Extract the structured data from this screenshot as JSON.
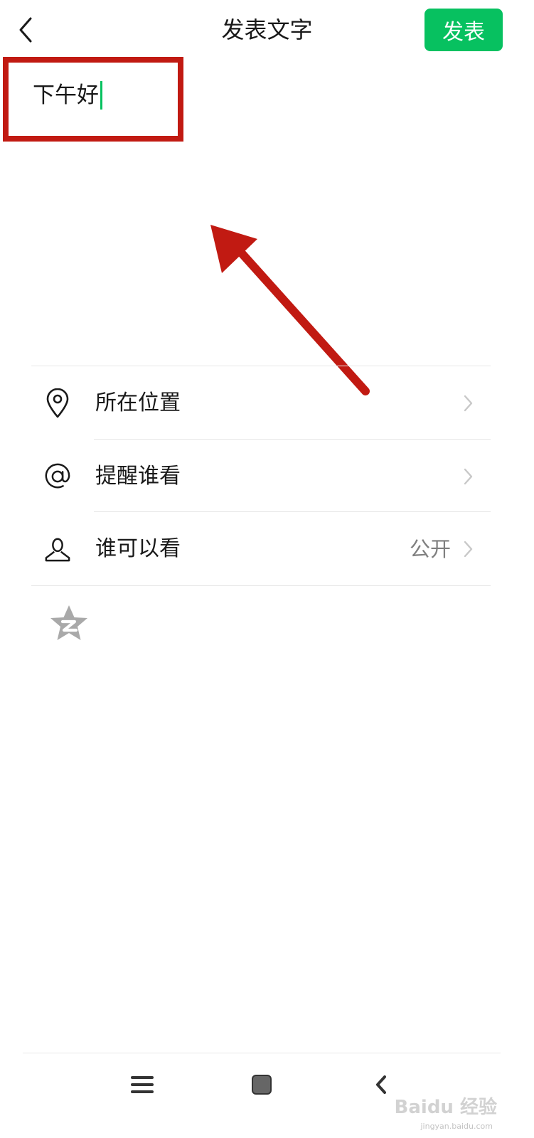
{
  "header": {
    "title": "发表文字",
    "publish_label": "发表",
    "back_icon": "chevron-left-icon"
  },
  "editor": {
    "text": "下午好"
  },
  "options": [
    {
      "label": "所在位置",
      "icon": "location-pin-icon",
      "value": ""
    },
    {
      "label": "提醒谁看",
      "icon": "at-sign-icon",
      "value": ""
    },
    {
      "label": "谁可以看",
      "icon": "person-icon",
      "value": "公开"
    }
  ],
  "share": {
    "icon": "qzone-icon"
  },
  "bottom_nav": {
    "items": [
      "menu-icon",
      "home-icon",
      "back-icon"
    ]
  },
  "watermark": {
    "logo_text": "Baidu 经验",
    "url_text": "jingyan.baidu.com"
  },
  "colors": {
    "accent_green": "#07c160",
    "annotation_red": "#c11a12",
    "value_gray": "#7f7f7f"
  }
}
